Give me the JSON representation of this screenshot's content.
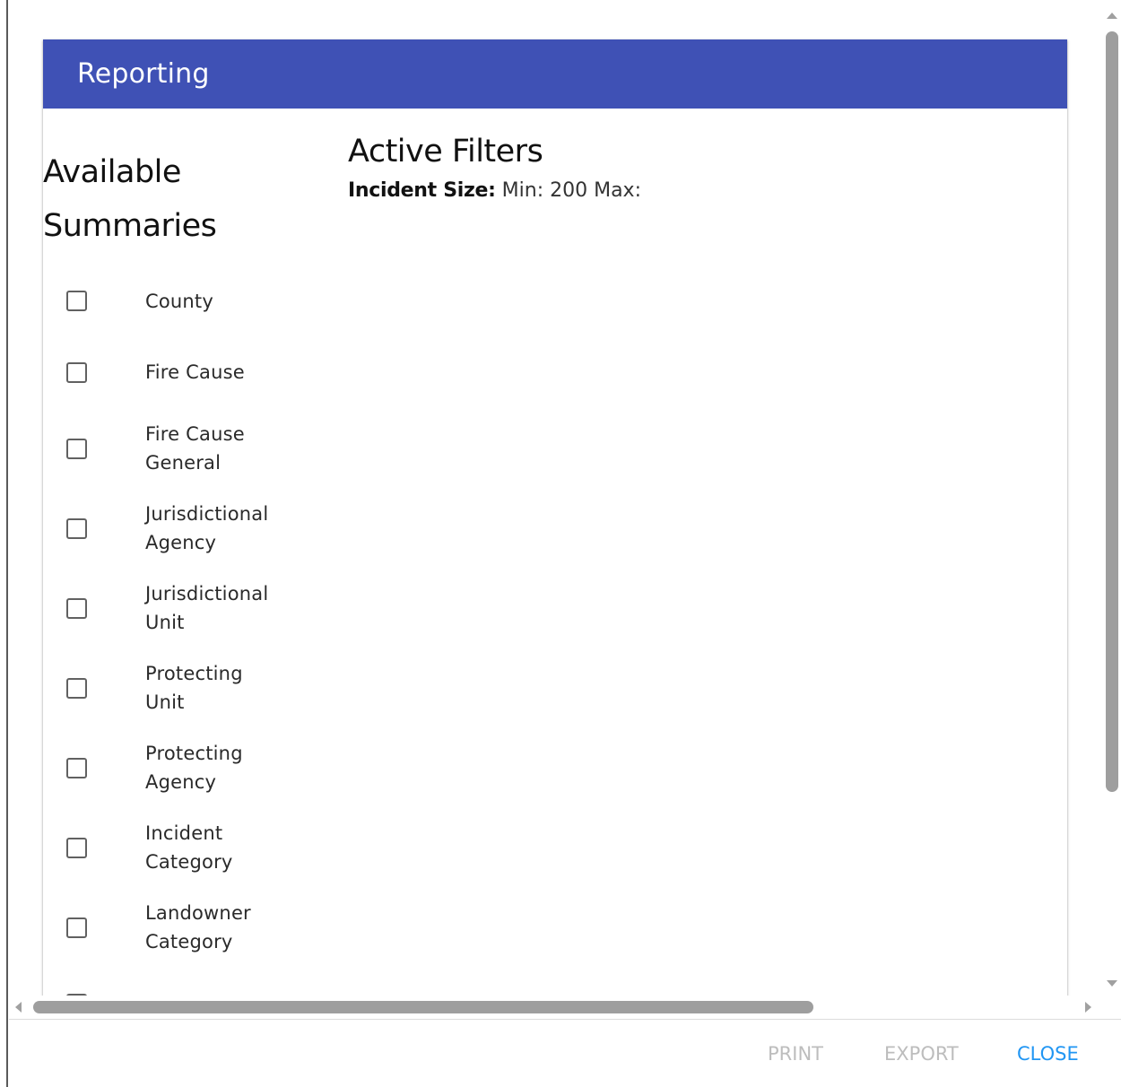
{
  "dialog": {
    "title": "Reporting"
  },
  "summaries": {
    "heading_line1": "Available",
    "heading_line2": "Summaries",
    "items": [
      {
        "line1": "County",
        "line2": "",
        "checked": false
      },
      {
        "line1": "Fire Cause",
        "line2": "",
        "checked": false
      },
      {
        "line1": "Fire Cause",
        "line2": "General",
        "checked": false
      },
      {
        "line1": "Jurisdictional",
        "line2": "Agency",
        "checked": false
      },
      {
        "line1": "Jurisdictional",
        "line2": "Unit",
        "checked": false
      },
      {
        "line1": "Protecting",
        "line2": "Unit",
        "checked": false
      },
      {
        "line1": "Protecting",
        "line2": "Agency",
        "checked": false
      },
      {
        "line1": "Incident",
        "line2": "Category",
        "checked": false
      },
      {
        "line1": "Landowner",
        "line2": "Category",
        "checked": false
      }
    ]
  },
  "filters": {
    "heading": "Active Filters",
    "incident_size_label": "Incident Size:",
    "incident_size_value": "Min: 200 Max:"
  },
  "actions": {
    "print_label": "PRINT",
    "export_label": "EXPORT",
    "close_label": "CLOSE"
  },
  "colors": {
    "header_bg": "#3f51b5",
    "close_accent": "#2196f3",
    "disabled_text": "#bdbdbd"
  }
}
